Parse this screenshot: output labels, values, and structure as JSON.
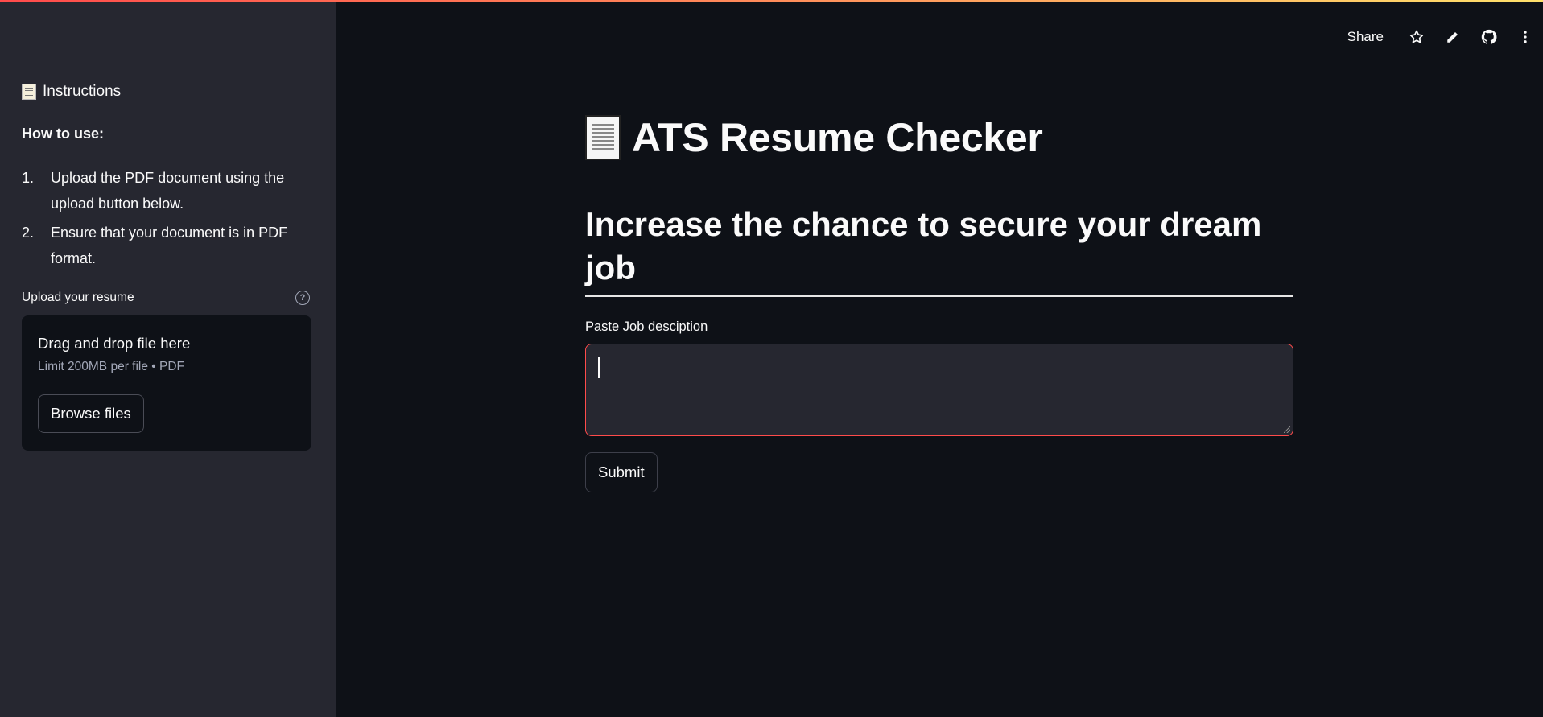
{
  "sidebar": {
    "section_title": "Instructions",
    "howto_heading": "How to use:",
    "steps": [
      {
        "num": "1.",
        "text": "Upload the PDF document using the upload button below."
      },
      {
        "num": "2.",
        "text": "Ensure that your document is in PDF format."
      }
    ],
    "upload": {
      "label": "Upload your resume",
      "drop_text": "Drag and drop file here",
      "limit_text": "Limit 200MB per file • PDF",
      "browse_label": "Browse files"
    }
  },
  "toolbar": {
    "share_label": "Share",
    "icons": [
      "star-icon",
      "pencil-icon",
      "github-icon",
      "more-vertical-icon"
    ]
  },
  "main": {
    "title": "ATS Resume Checker",
    "subtitle": "Increase the chance to secure your dream job",
    "job_description": {
      "label": "Paste Job desciption",
      "value": ""
    },
    "submit_label": "Submit"
  },
  "colors": {
    "sidebar_bg": "#262730",
    "main_bg": "#0e1117",
    "accent_red": "#ff4b4b",
    "text": "#fafafa",
    "muted_text": "#a3a8b8"
  }
}
